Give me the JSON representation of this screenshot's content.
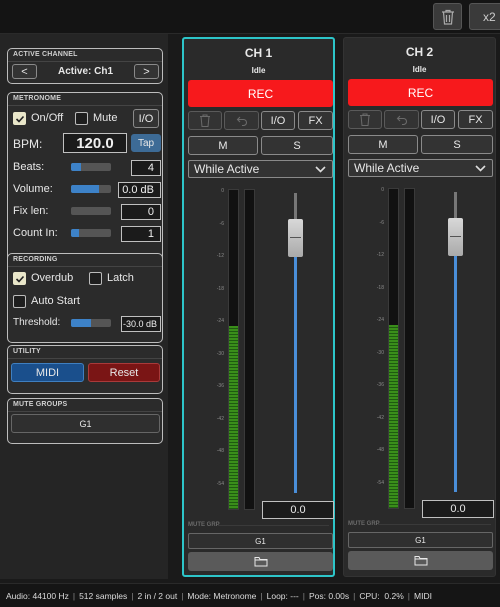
{
  "topbar": {
    "trash_icon": "trash-icon",
    "zoom_label": "x2"
  },
  "sidebar": {
    "active_channel": {
      "title": "ACTIVE CHANNEL",
      "prev_label": "<",
      "next_label": ">",
      "label": "Active: Ch1"
    },
    "metronome": {
      "title": "METRONOME",
      "onoff_label": "On/Off",
      "onoff_checked": true,
      "mute_label": "Mute",
      "mute_checked": false,
      "io_label": "I/O",
      "bpm_label": "BPM:",
      "bpm_value": "120.0",
      "tap_label": "Tap",
      "beats_label": "Beats:",
      "beats_value": "4",
      "beats_level": 0.25,
      "volume_label": "Volume:",
      "volume_value": "0.0 dB",
      "volume_level": 0.7,
      "fixlen_label": "Fix len:",
      "fixlen_value": "0",
      "fixlen_level": 0.0,
      "countin_label": "Count In:",
      "countin_value": "1",
      "countin_level": 0.2
    },
    "recording": {
      "title": "RECORDING",
      "overdub_label": "Overdub",
      "overdub_checked": true,
      "latch_label": "Latch",
      "latch_checked": false,
      "autostart_label": "Auto Start",
      "autostart_checked": false,
      "threshold_label": "Threshold:",
      "threshold_value": "-30.0 dB",
      "threshold_level": 0.5
    },
    "utility": {
      "title": "UTILITY",
      "midi_label": "MIDI",
      "reset_label": "Reset"
    },
    "mute_groups": {
      "title": "MUTE GROUPS",
      "group_label": "G1"
    }
  },
  "channels": [
    {
      "name": "CH 1",
      "state": "Idle",
      "rec_label": "REC",
      "io_label": "I/O",
      "fx_label": "FX",
      "m_label": "M",
      "s_label": "S",
      "mode": "While Active",
      "fader_value": "0.0",
      "fader_level": 0.85,
      "meter_level": 0.57,
      "mute_grp_label": "MUTE GRP",
      "group_label": "G1"
    },
    {
      "name": "CH 2",
      "state": "Idle",
      "rec_label": "REC",
      "io_label": "I/O",
      "fx_label": "FX",
      "m_label": "M",
      "s_label": "S",
      "mode": "While Active",
      "fader_value": "0.0",
      "fader_level": 0.85,
      "meter_level": 0.57,
      "mute_grp_label": "MUTE GRP",
      "group_label": "G1"
    }
  ],
  "scale_labels": [
    "0",
    "-6",
    "-12",
    "-18",
    "-24",
    "-30",
    "-36",
    "-42",
    "-48",
    "-54"
  ],
  "status": {
    "audio": "Audio: 44100 Hz",
    "samples": "512 samples",
    "io": "2 in / 2 out",
    "mode": "Mode: Metronome",
    "loop": "Loop: ---",
    "pos": "Pos: 0.00s",
    "cpu_label": "CPU:",
    "cpu_value": "0.2%",
    "midi": "MIDI"
  },
  "colors": {
    "accent": "#2dc5c9",
    "rec": "#f7191c",
    "midi": "#1a4f8c",
    "reset": "#7a1515",
    "meter": "#3a8e1a",
    "slider": "#3d82c8"
  }
}
